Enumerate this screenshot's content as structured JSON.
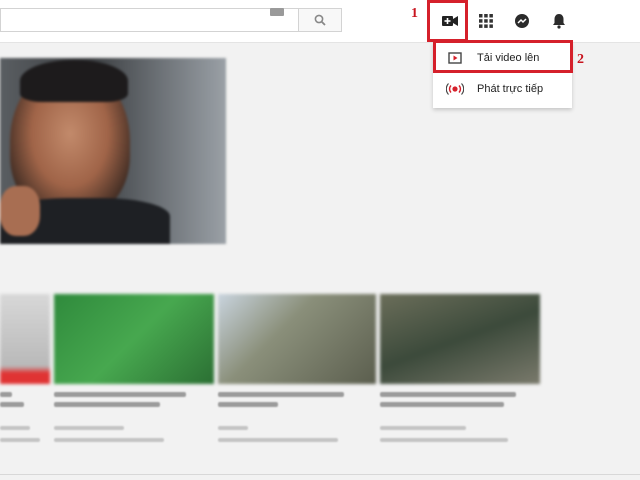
{
  "header": {
    "search": {
      "value": "",
      "placeholder": ""
    },
    "icons": {
      "keyboard": "keyboard-icon",
      "search": "search-icon",
      "create_video": "video-camera-plus-icon",
      "apps": "apps-grid-icon",
      "messages": "messages-icon",
      "notifications": "bell-icon"
    }
  },
  "annotations": {
    "step1": "1",
    "step2": "2",
    "highlight_color": "#d5202b"
  },
  "create_menu": {
    "items": [
      {
        "label": "Tải video lên",
        "icon": "upload-video-icon"
      },
      {
        "label": "Phát trực tiếp",
        "icon": "live-broadcast-icon"
      }
    ]
  },
  "colors": {
    "accent_red": "#d5202b",
    "background": "#f2f2f2"
  }
}
